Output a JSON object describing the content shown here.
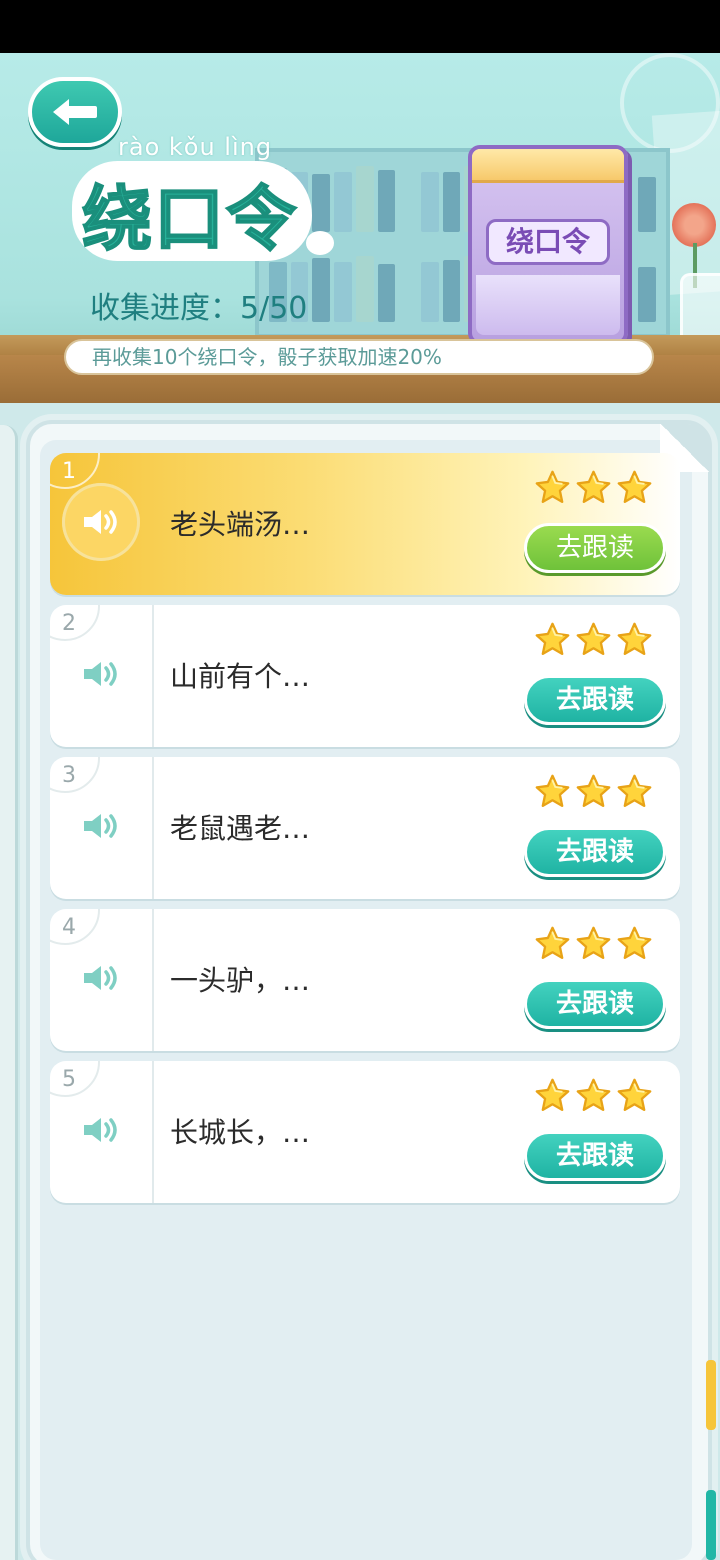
{
  "header": {
    "pinyin": "rào kǒu lìng",
    "title": "绕口令",
    "progress_label": "收集进度：5/50",
    "book_label": "绕口令",
    "hint": "再收集10个绕口令，骰子获取加速20%"
  },
  "list": {
    "items": [
      {
        "index": "1",
        "text": "老头端汤…",
        "stars": 3,
        "button": "去跟读",
        "active": true
      },
      {
        "index": "2",
        "text": "山前有个…",
        "stars": 3,
        "button": "去跟读",
        "active": false
      },
      {
        "index": "3",
        "text": "老鼠遇老…",
        "stars": 3,
        "button": "去跟读",
        "active": false
      },
      {
        "index": "4",
        "text": "一头驴，…",
        "stars": 3,
        "button": "去跟读",
        "active": false
      },
      {
        "index": "5",
        "text": "长城长，…",
        "stars": 3,
        "button": "去跟读",
        "active": false
      }
    ]
  },
  "icons": {
    "back": "back-arrow-icon",
    "speaker": "speaker-icon",
    "star": "star-icon"
  },
  "colors": {
    "teal": "#1fb3a3",
    "green": "#6fc23a",
    "gold": "#f6c53a",
    "purple": "#8e6bc4"
  }
}
